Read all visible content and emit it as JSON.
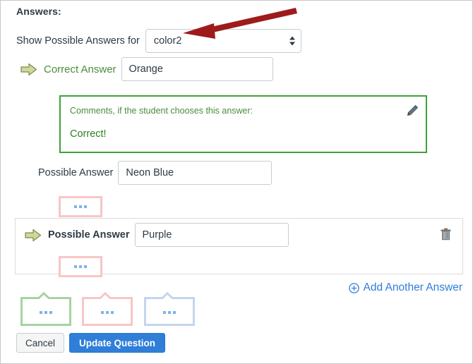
{
  "panel": {
    "heading": "Answers:"
  },
  "show_answers": {
    "label": "Show Possible Answers for",
    "selected_value": "color2",
    "icon": "updown-arrows-icon"
  },
  "annotation": {
    "arrow_color": "#9e1b1b",
    "icon": "red-pointer-arrow-icon"
  },
  "correct_answer": {
    "kind_label": "Correct Answer",
    "value": "Orange",
    "arrow_icon": "green-arrow-icon",
    "kind_color": "#4b8b3b"
  },
  "comments": {
    "prompt": "Comments, if the student chooses this answer:",
    "value": "Correct!",
    "border_color": "#3fa037",
    "edit_icon": "pencil-icon"
  },
  "answers": [
    {
      "kind_label": "Possible Answer",
      "value": "Neon Blue",
      "has_arrow": false,
      "selected": false
    },
    {
      "kind_label": "Possible Answer",
      "value": "Purple",
      "has_arrow": true,
      "selected": true,
      "delete_icon": "trash-icon"
    }
  ],
  "placeholder_boxes": {
    "dots": "...",
    "pink_border": "#f7c6c6",
    "dot_color": "#7eb4e8"
  },
  "add_another": {
    "label": "Add Another Answer",
    "icon": "plus-circle-icon",
    "color": "#2f7ed8"
  },
  "callouts": [
    {
      "name": "green-callout",
      "color": "#a6d3a0",
      "dots": "..."
    },
    {
      "name": "pink-callout",
      "color": "#f7c6c6",
      "dots": "..."
    },
    {
      "name": "blue-callout",
      "color": "#c5d5ec",
      "dots": "..."
    }
  ],
  "footer": {
    "cancel_label": "Cancel",
    "update_label": "Update Question",
    "primary_color": "#2f7ed8"
  }
}
